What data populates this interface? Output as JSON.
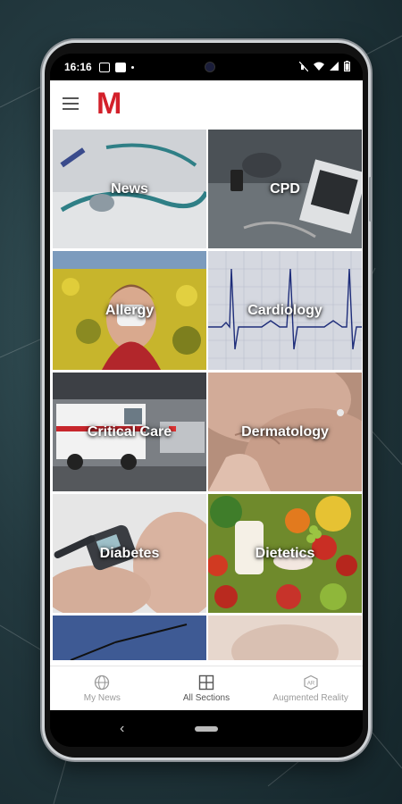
{
  "status_bar": {
    "time": "16:16"
  },
  "app_bar": {
    "logo_text": "M"
  },
  "sections": [
    {
      "label": "News"
    },
    {
      "label": "CPD"
    },
    {
      "label": "Allergy"
    },
    {
      "label": "Cardiology"
    },
    {
      "label": "Critical Care"
    },
    {
      "label": "Dermatology"
    },
    {
      "label": "Diabetes"
    },
    {
      "label": "Dietetics"
    }
  ],
  "bottom_nav": [
    {
      "label": "My News",
      "icon": "globe-icon",
      "active": false
    },
    {
      "label": "All Sections",
      "icon": "grid-icon",
      "active": true
    },
    {
      "label": "Augmented Reality",
      "icon": "ar-cube-icon",
      "active": false
    }
  ],
  "colors": {
    "brand": "#d3202a",
    "accent_active": "#555555",
    "inactive": "#9a9a9a"
  }
}
